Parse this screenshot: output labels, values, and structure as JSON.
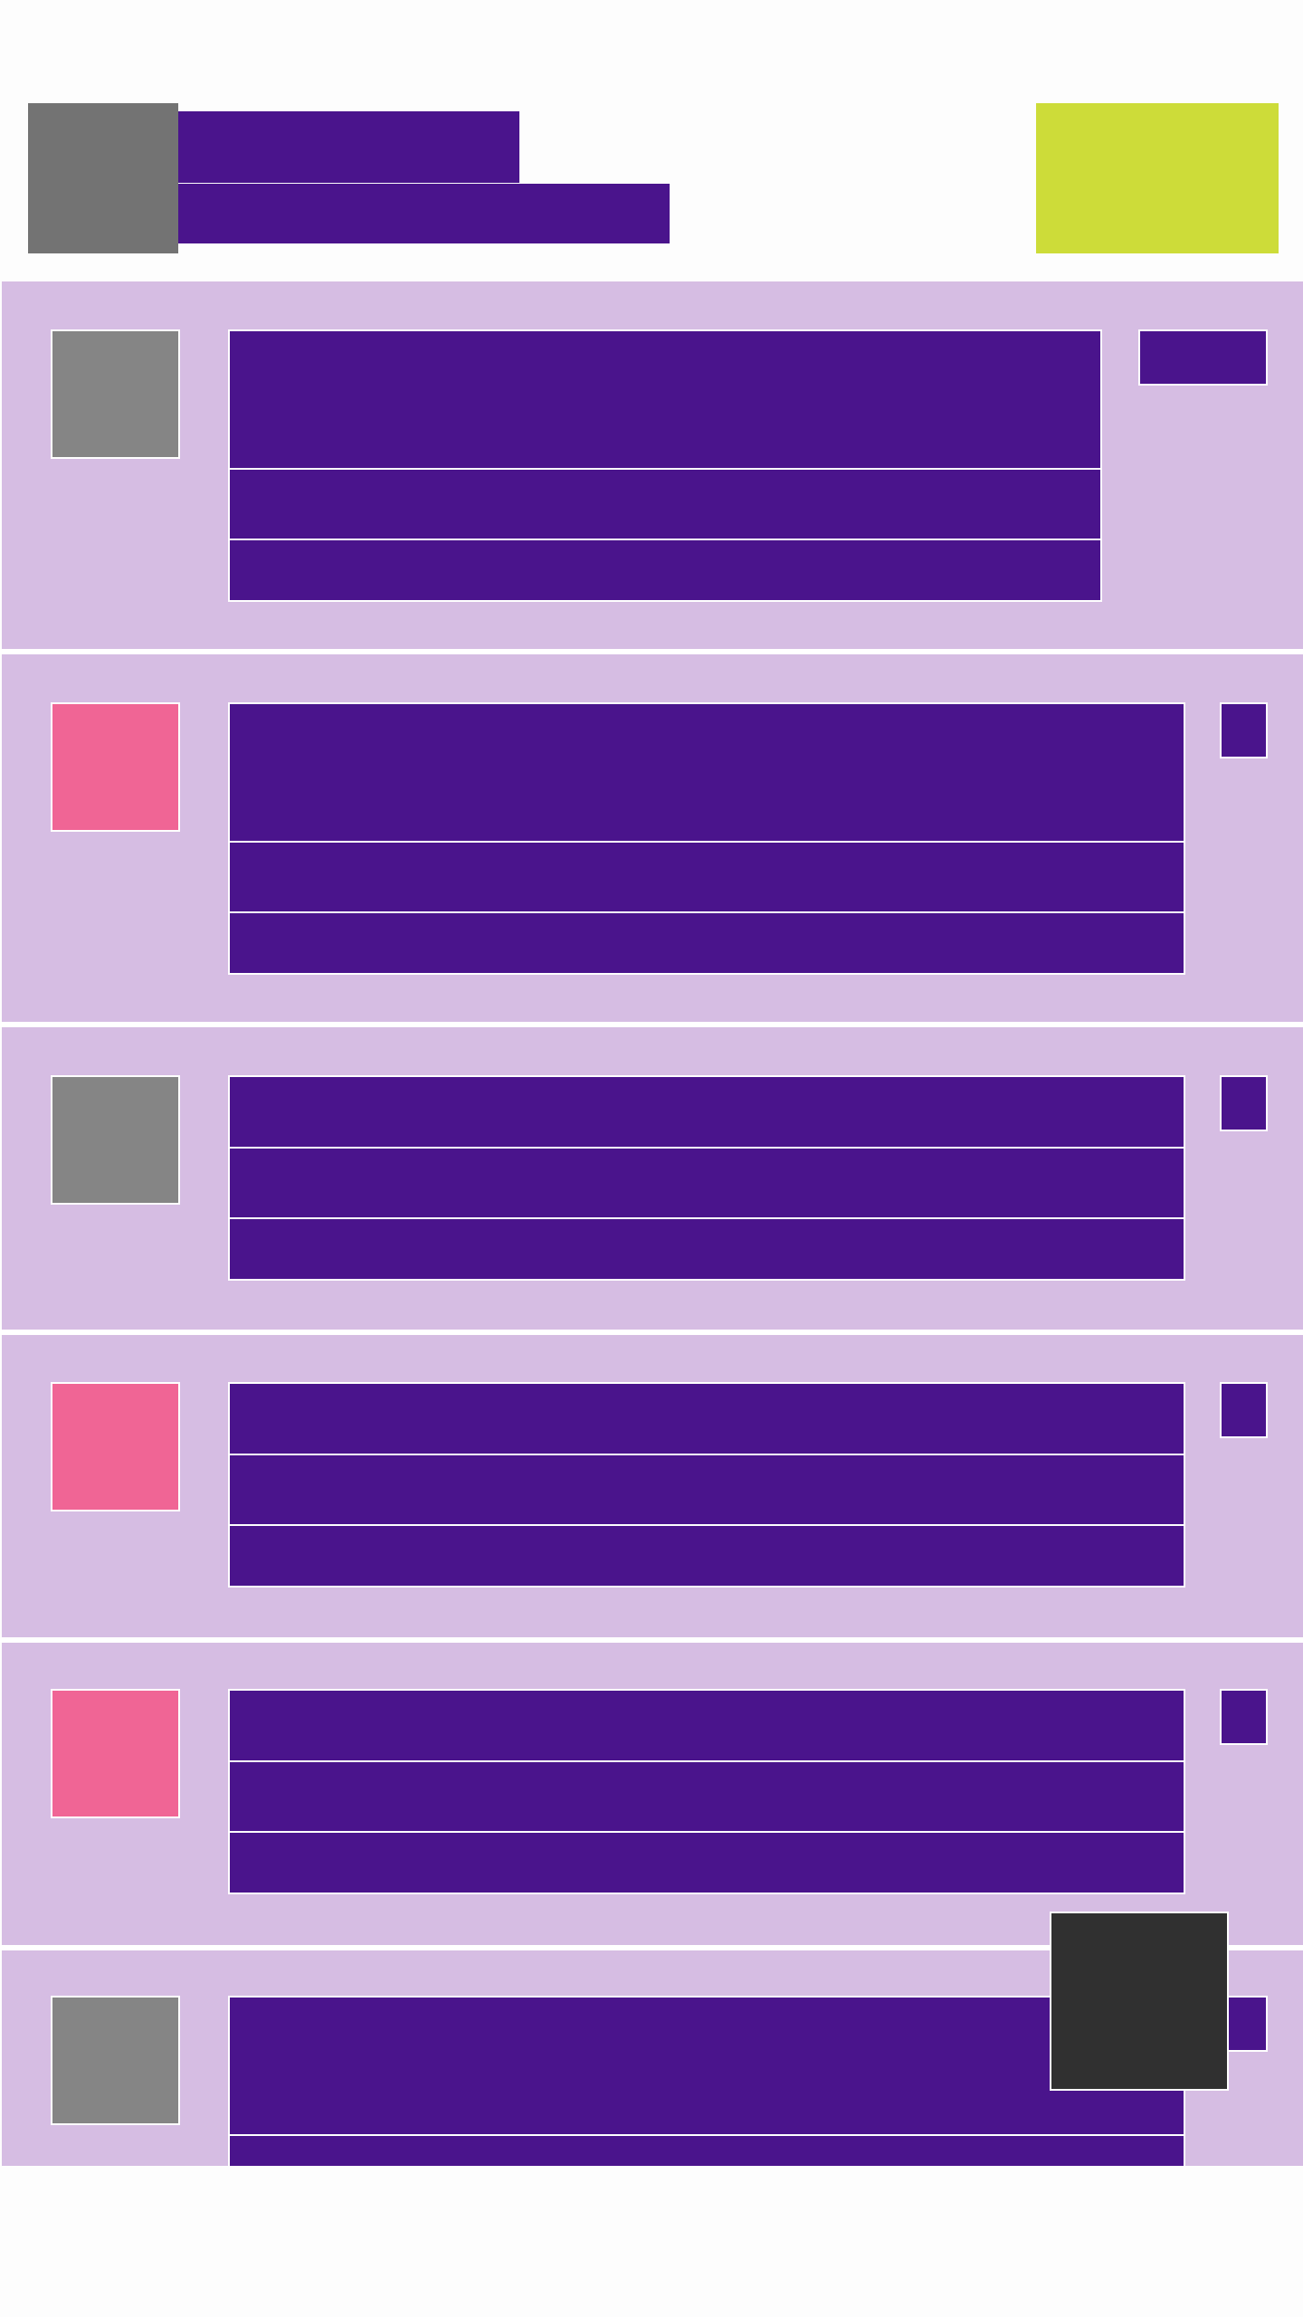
{
  "colors": {
    "background": "#fdfdfd",
    "header_avatar": "#737373",
    "header_action": "#cddc39",
    "row_background": "#d6bde3",
    "text_block": "#4a148c",
    "thumbnail_gray": "#858585",
    "thumbnail_pink": "#f06595",
    "floating_button": "#303030"
  },
  "header": {
    "title": "",
    "subtitle": "",
    "action_label": ""
  },
  "rows": [
    {
      "title": "",
      "line1": "",
      "line2": "",
      "meta": "",
      "thumbnail": "gray"
    },
    {
      "title": "",
      "line1": "",
      "line2": "",
      "meta": "",
      "thumbnail": "pink"
    },
    {
      "title": "",
      "line1": "",
      "line2": "",
      "meta": "",
      "thumbnail": "gray"
    },
    {
      "title": "",
      "line1": "",
      "line2": "",
      "meta": "",
      "thumbnail": "pink"
    },
    {
      "title": "",
      "line1": "",
      "line2": "",
      "meta": "",
      "thumbnail": "pink"
    },
    {
      "title": "",
      "line1": "",
      "line2": "",
      "meta": "",
      "thumbnail": "gray"
    }
  ],
  "floating_button": {
    "icon": "square-icon"
  }
}
